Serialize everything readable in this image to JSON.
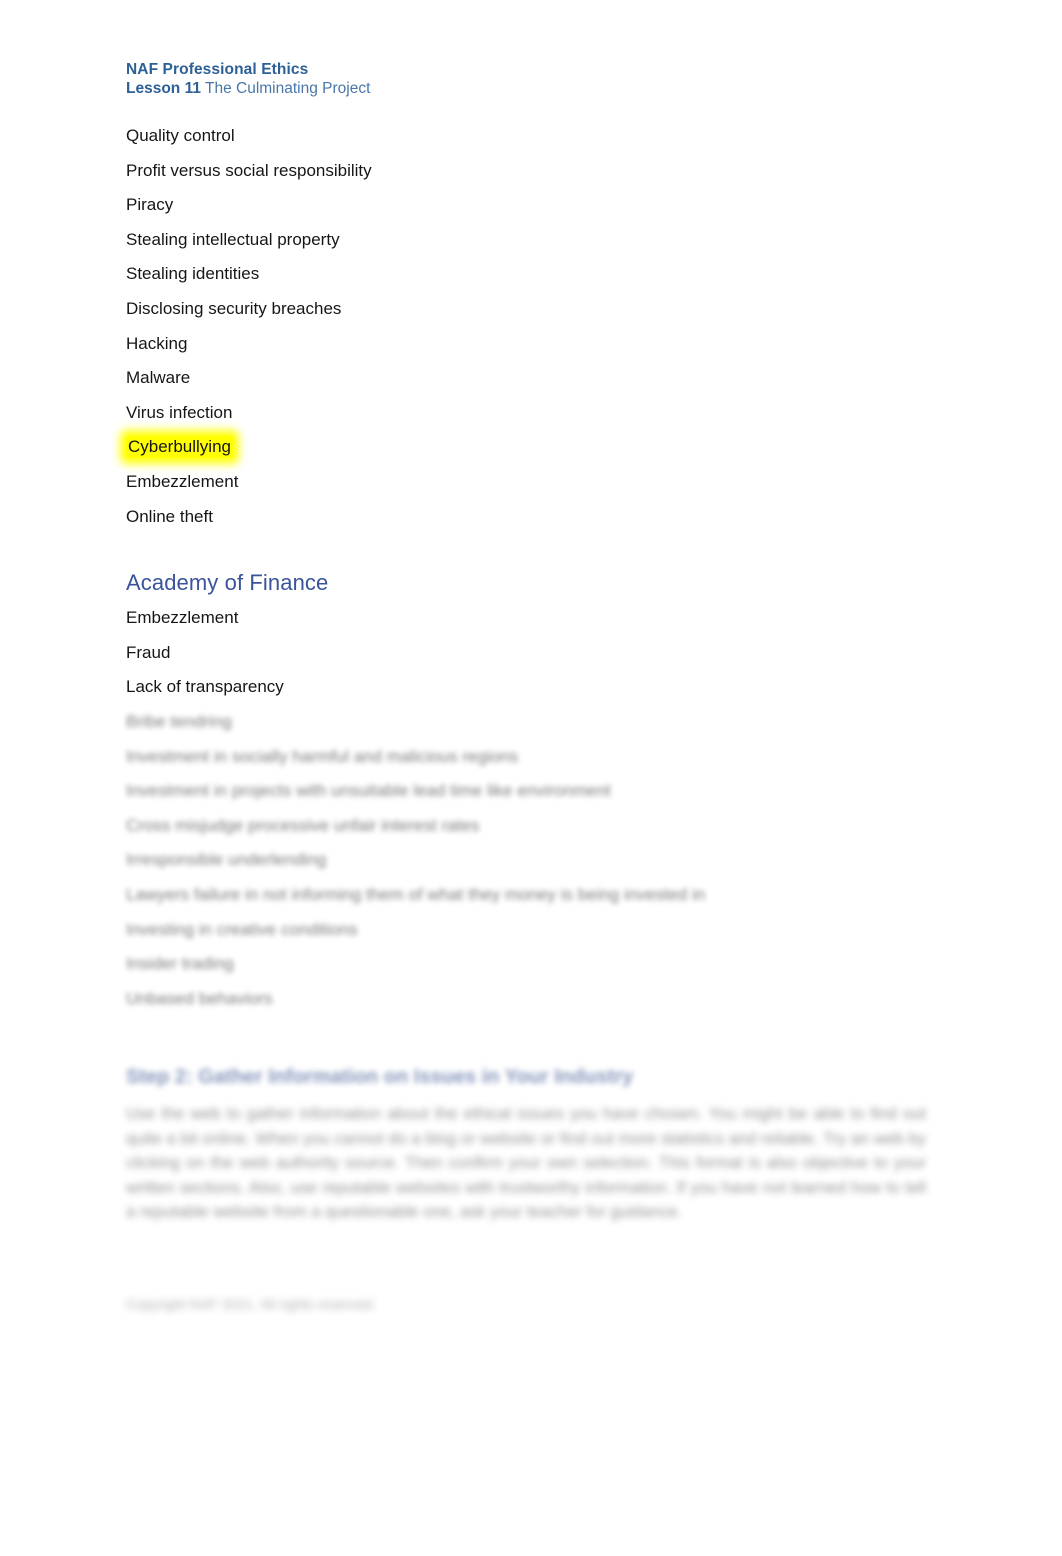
{
  "header": {
    "program_title": "NAF Professional Ethics",
    "lesson_label": "Lesson 11",
    "lesson_title": " The Culminating Project"
  },
  "first_list": {
    "items": [
      {
        "label": "Quality control",
        "highlighted": false
      },
      {
        "label": "Profit versus social responsibility",
        "highlighted": false
      },
      {
        "label": "Piracy",
        "highlighted": false
      },
      {
        "label": "Stealing intellectual property",
        "highlighted": false
      },
      {
        "label": "Stealing identities",
        "highlighted": false
      },
      {
        "label": "Disclosing security breaches",
        "highlighted": false
      },
      {
        "label": "Hacking",
        "highlighted": false
      },
      {
        "label": "Malware",
        "highlighted": false
      },
      {
        "label": "Virus infection",
        "highlighted": false
      },
      {
        "label": "Cyberbullying",
        "highlighted": true
      },
      {
        "label": "Embezzlement",
        "highlighted": false
      },
      {
        "label": "Online theft",
        "highlighted": false
      }
    ]
  },
  "finance_section": {
    "heading": "Academy of Finance",
    "items": [
      "Embezzlement",
      "Fraud",
      "Lack of transparency"
    ],
    "blurred_items": [
      "Bribe tendring",
      "Investment in socially harmful and malicious regions",
      "Investment in projects with unsuitable lead time like environment",
      "Cross misjudge processive unfair interest rates",
      "Irresponsible underlending",
      "Lawyers failure in not informing them of what they money is being invested in",
      "Investing in creative conditions",
      "Insider trading",
      "Unbased behaviors"
    ]
  },
  "step_section": {
    "heading": "Step 2: Gather Information on Issues in Your Industry",
    "paragraph": "Use the web to gather information about the ethical issues you have chosen. You might be able to find out quite a bit online. When you cannot do a blog or website or find out more statistics and reliable. Try an web by clicking on the web authority source. Then confirm your own selection. This format is also objective to your written sections. Also, use reputable websites with trustworthy information. If you have not learned how to tell a reputable website from a questionable one, ask your teacher for guidance."
  },
  "footer": {
    "copyright": "Copyright NAF 2021. All rights reserved."
  },
  "colors": {
    "header_blue": "#2d6096",
    "header_blue_light": "#4a77a8",
    "section_blue": "#3a539b",
    "highlight_yellow": "#ffff00",
    "body_text": "#161616",
    "page_background": "#ffffff"
  }
}
